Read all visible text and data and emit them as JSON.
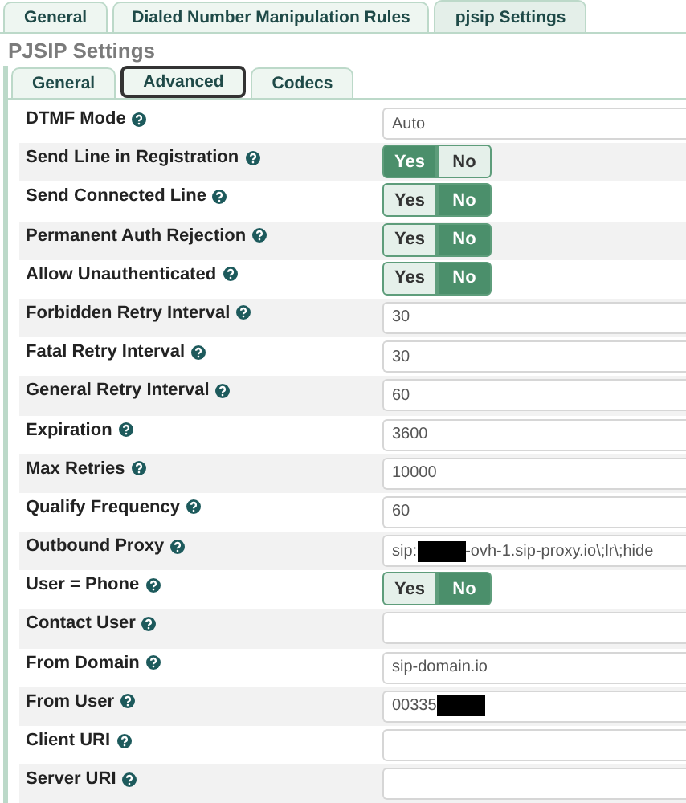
{
  "tabs": [
    {
      "label": "General",
      "selected": false
    },
    {
      "label": "Dialed Number Manipulation Rules",
      "selected": false
    },
    {
      "label": "pjsip Settings",
      "selected": true
    }
  ],
  "section_title": "PJSIP Settings",
  "subtabs": [
    {
      "label": "General",
      "selected": false
    },
    {
      "label": "Advanced",
      "selected": true
    },
    {
      "label": "Codecs",
      "selected": false
    }
  ],
  "settings": [
    {
      "label": "DTMF Mode",
      "kind": "text",
      "segments": [
        {
          "kind": "text",
          "text": "Auto"
        }
      ]
    },
    {
      "label": "Send Line in Registration",
      "kind": "toggle",
      "on": true,
      "yes": "Yes",
      "no": "No"
    },
    {
      "label": "Send Connected Line",
      "kind": "toggle",
      "on": false,
      "yes": "Yes",
      "no": "No"
    },
    {
      "label": "Permanent Auth Rejection",
      "kind": "toggle",
      "on": false,
      "yes": "Yes",
      "no": "No"
    },
    {
      "label": "Allow Unauthenticated",
      "kind": "toggle",
      "on": false,
      "yes": "Yes",
      "no": "No"
    },
    {
      "label": "Forbidden Retry Interval",
      "kind": "text",
      "segments": [
        {
          "kind": "text",
          "text": "30"
        }
      ]
    },
    {
      "label": "Fatal Retry Interval",
      "kind": "text",
      "segments": [
        {
          "kind": "text",
          "text": "30"
        }
      ]
    },
    {
      "label": "General Retry Interval",
      "kind": "text",
      "segments": [
        {
          "kind": "text",
          "text": "60"
        }
      ]
    },
    {
      "label": "Expiration",
      "kind": "text",
      "segments": [
        {
          "kind": "text",
          "text": "3600"
        }
      ]
    },
    {
      "label": "Max Retries",
      "kind": "text",
      "segments": [
        {
          "kind": "text",
          "text": "10000"
        }
      ]
    },
    {
      "label": "Qualify Frequency",
      "kind": "text",
      "segments": [
        {
          "kind": "text",
          "text": "60"
        }
      ]
    },
    {
      "label": "Outbound Proxy",
      "kind": "text",
      "segments": [
        {
          "kind": "text",
          "text": "sip:"
        },
        {
          "kind": "redaction"
        },
        {
          "kind": "text",
          "text": "-ovh-1.sip-proxy.io\\;lr\\;hide"
        }
      ]
    },
    {
      "label": "User = Phone",
      "kind": "toggle",
      "on": false,
      "yes": "Yes",
      "no": "No"
    },
    {
      "label": "Contact User",
      "kind": "text"
    },
    {
      "label": "From Domain",
      "kind": "text",
      "segments": [
        {
          "kind": "text",
          "text": "sip-domain.io"
        }
      ]
    },
    {
      "label": "From User",
      "kind": "text",
      "segments": [
        {
          "kind": "text",
          "text": "00335"
        },
        {
          "kind": "redaction"
        }
      ]
    },
    {
      "label": "Client URI",
      "kind": "text"
    },
    {
      "label": "Server URI",
      "kind": "text"
    }
  ]
}
